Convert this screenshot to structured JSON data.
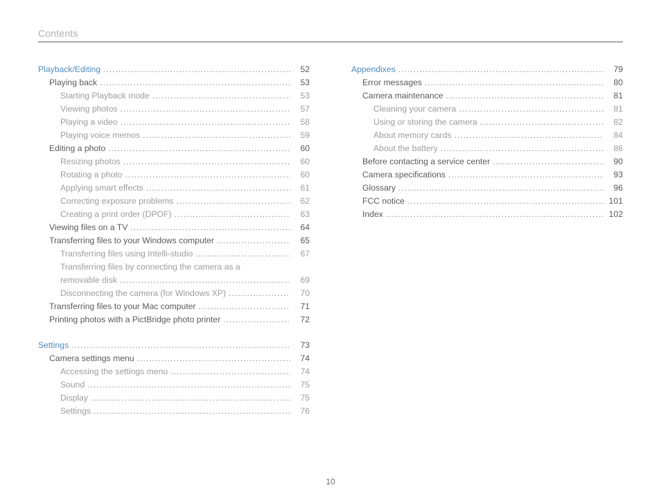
{
  "header": {
    "title": "Contents"
  },
  "page_number": "10",
  "column_left": [
    {
      "label": "Playback/Editing",
      "page": "52",
      "level": 0,
      "section": true
    },
    {
      "label": "Playing back",
      "page": "53",
      "level": 1
    },
    {
      "label": "Starting Playback mode",
      "page": "53",
      "level": 2
    },
    {
      "label": "Viewing photos",
      "page": "57",
      "level": 2
    },
    {
      "label": "Playing a video",
      "page": "58",
      "level": 2
    },
    {
      "label": "Playing voice memos",
      "page": "59",
      "level": 2
    },
    {
      "label": "Editing a photo",
      "page": "60",
      "level": 1
    },
    {
      "label": "Resizing photos",
      "page": "60",
      "level": 2
    },
    {
      "label": "Rotating a photo",
      "page": "60",
      "level": 2
    },
    {
      "label": "Applying smart effects",
      "page": "61",
      "level": 2
    },
    {
      "label": "Correcting exposure problems",
      "page": "62",
      "level": 2
    },
    {
      "label": "Creating a print order (DPOF)",
      "page": "63",
      "level": 2
    },
    {
      "label": "Viewing files on a TV",
      "page": "64",
      "level": 1
    },
    {
      "label": "Transferring files to your Windows computer",
      "page": "65",
      "level": 1
    },
    {
      "label": "Transferring files using Intelli-studio",
      "page": "67",
      "level": 2
    },
    {
      "wrap_first": "Transferring files by connecting the camera as a",
      "wrap_cont": "removable disk",
      "page": "69",
      "level": 2
    },
    {
      "label": "Disconnecting the camera (for Windows XP)",
      "page": "70",
      "level": 2
    },
    {
      "label": "Transferring files to your Mac computer",
      "page": "71",
      "level": 1
    },
    {
      "label": "Printing photos with a PictBridge photo printer",
      "page": "72",
      "level": 1
    },
    {
      "gap": true
    },
    {
      "label": "Settings",
      "page": "73",
      "level": 0,
      "section": true
    },
    {
      "label": "Camera settings menu",
      "page": "74",
      "level": 1
    },
    {
      "label": "Accessing the settings menu",
      "page": "74",
      "level": 2
    },
    {
      "label": "Sound",
      "page": "75",
      "level": 2
    },
    {
      "label": "Display",
      "page": "75",
      "level": 2
    },
    {
      "label": "Settings",
      "page": "76",
      "level": 2
    }
  ],
  "column_right": [
    {
      "label": "Appendixes",
      "page": "79",
      "level": 0,
      "section": true
    },
    {
      "label": "Error messages",
      "page": "80",
      "level": 1
    },
    {
      "label": "Camera maintenance",
      "page": "81",
      "level": 1
    },
    {
      "label": "Cleaning your camera",
      "page": "81",
      "level": 2
    },
    {
      "label": "Using or storing the camera",
      "page": "82",
      "level": 2
    },
    {
      "label": "About memory cards",
      "page": "84",
      "level": 2
    },
    {
      "label": "About the battery",
      "page": "86",
      "level": 2
    },
    {
      "label": "Before contacting a service center",
      "page": "90",
      "level": 1
    },
    {
      "label": "Camera specifications",
      "page": "93",
      "level": 1
    },
    {
      "label": "Glossary",
      "page": "96",
      "level": 1
    },
    {
      "label": "FCC notice",
      "page": "101",
      "level": 1
    },
    {
      "label": "Index",
      "page": "102",
      "level": 1
    }
  ]
}
